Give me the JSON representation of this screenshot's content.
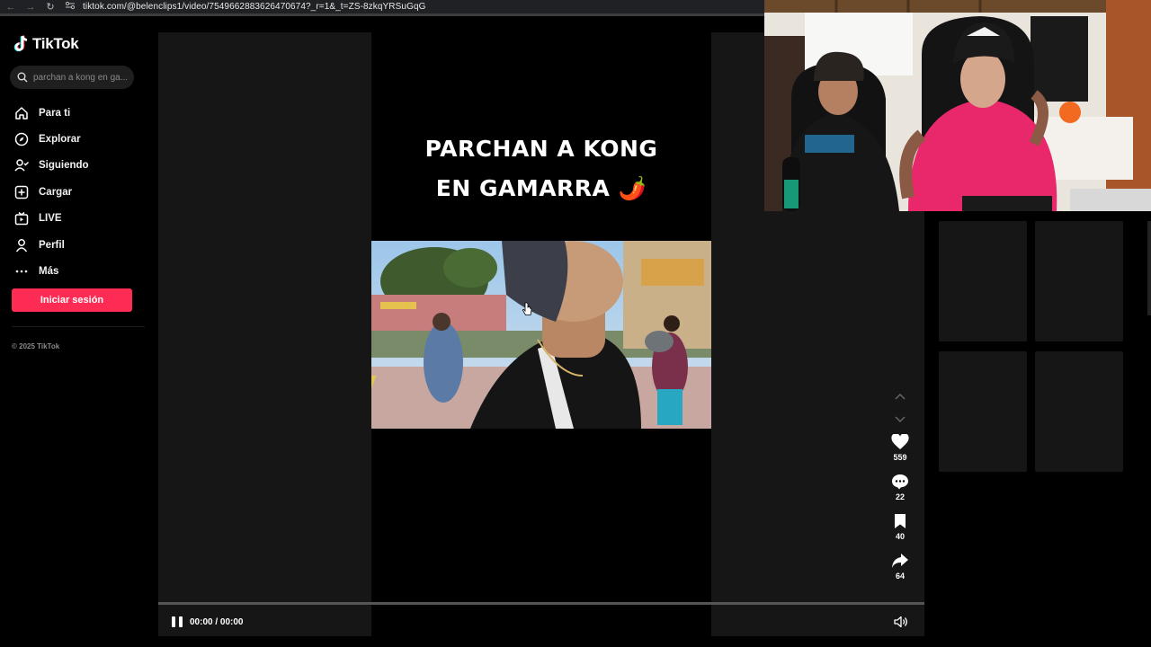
{
  "browser": {
    "url": "tiktok.com/@belenclips1/video/7549662883626470674?_r=1&_t=ZS-8zkqYRSuGqG",
    "nav_icons": [
      "back-icon",
      "forward-icon",
      "reload-icon",
      "site-settings-icon"
    ]
  },
  "sidebar": {
    "logo_text": "TikTok",
    "search_placeholder": "parchan a kong en ga...",
    "items": [
      {
        "label": "Para ti",
        "icon": "home-icon"
      },
      {
        "label": "Explorar",
        "icon": "compass-icon"
      },
      {
        "label": "Siguiendo",
        "icon": "following-icon"
      },
      {
        "label": "Cargar",
        "icon": "upload-icon"
      },
      {
        "label": "LIVE",
        "icon": "live-icon"
      },
      {
        "label": "Perfil",
        "icon": "profile-icon"
      },
      {
        "label": "Más",
        "icon": "more-icon"
      }
    ],
    "login_label": "Iniciar sesión",
    "copyright": "© 2025 TikTok"
  },
  "video": {
    "caption_line1": "PARCHAN A KONG",
    "caption_line2": "EN GAMARRA 🌶️",
    "time": "00:00 / 00:00",
    "progress": 1.0
  },
  "actions": {
    "likes": "559",
    "comments": "22",
    "saves": "40",
    "shares": "64"
  },
  "colors": {
    "accent": "#fe2c55",
    "background": "#000000",
    "panel": "#161616"
  }
}
